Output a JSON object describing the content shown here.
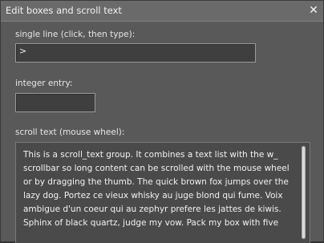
{
  "window": {
    "title": "Edit boxes and scroll text",
    "close_glyph": "✕"
  },
  "single_line": {
    "label": "single line (click, then type):",
    "value": ">"
  },
  "integer_entry": {
    "label": "integer entry:",
    "value": ""
  },
  "scroll_text": {
    "label": "scroll text (mouse wheel):",
    "lines": [
      "This is a scroll_text group.  It combines a text list with the w_",
      "scrollbar so long content can be scrolled with the mouse wheel",
      "or by dragging the thumb.  The quick brown fox jumps over the",
      "lazy dog.  Portez ce vieux whisky au juge blond qui fume.  Voix",
      "ambigue d'un coeur qui au zephyr prefere les jattes de kiwis.",
      "Sphinx of black quartz,  judge my vow.  Pack my box with five"
    ],
    "scroll_position": 0,
    "visible_fraction": 0.95
  },
  "colors": {
    "window_bg": "#595959",
    "field_bg": "#3f3f3f",
    "text": "#f2f2f2"
  },
  "icons": {
    "close": "close-icon"
  }
}
